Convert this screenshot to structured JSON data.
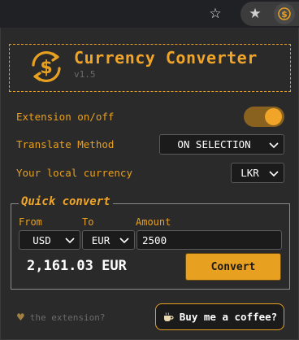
{
  "browser": {
    "icons": [
      "star-outline-icon",
      "star-filled-icon",
      "currency-converter-extension-icon"
    ]
  },
  "header": {
    "title": "Currency Converter",
    "version": "v1.5",
    "logo_icon": "dollar-exchange-icon"
  },
  "settings": {
    "toggle_label": "Extension on/off",
    "toggle_on": true,
    "method_label": "Translate Method",
    "method_value": "ON SELECTION",
    "local_label": "Your local currency",
    "local_value": "LKR"
  },
  "quick": {
    "legend": "Quick convert",
    "from_label": "From",
    "to_label": "To",
    "amount_label": "Amount",
    "from_value": "USD",
    "to_value": "EUR",
    "amount_value": "2500",
    "result": "2,161.03 EUR",
    "convert_label": "Convert"
  },
  "footer": {
    "heart_icon": "heart-icon",
    "like_text": "the extension?",
    "coffee_label": "Buy me a coffee?",
    "coffee_icon": "coffee-cup-icon"
  },
  "colors": {
    "accent": "#e8a020",
    "background": "#2a2a2a",
    "field": "#1b1b1b"
  }
}
